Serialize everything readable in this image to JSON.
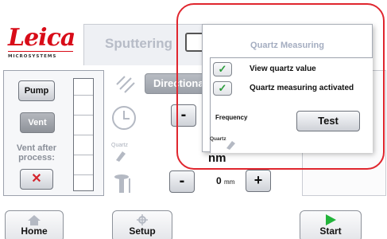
{
  "app": {
    "logo_text": "Leica",
    "logo_subtext": "MICROSYSTEMS",
    "tab_label": "Sputtering"
  },
  "left_panel": {
    "pump_label": "Pump",
    "vent_label": "Vent",
    "vent_after_label": "Vent after process:",
    "vent_after_value": "✕"
  },
  "middle": {
    "direction_label": "Directional",
    "quartz_icon_label": "Quartz",
    "minus_label": "-",
    "plus_label": "+",
    "thickness_unit": "nm",
    "distance_value": "0",
    "distance_unit": "mm"
  },
  "popup": {
    "title": "Quartz Measuring",
    "options": [
      {
        "label": "View quartz value",
        "checked": true,
        "mark": "✓"
      },
      {
        "label": "Quartz measuring activated",
        "checked": true,
        "mark": "✓"
      }
    ],
    "frequency_label": "Frequency",
    "test_button": "Test",
    "quartz_label": "Quartz"
  },
  "bottom_nav": {
    "home": "Home",
    "setup": "Setup",
    "start": "Start"
  },
  "colors": {
    "brand_red": "#d80c18",
    "highlight_red": "#e0262e",
    "check_green": "#2a9b3a",
    "start_green": "#22b43a"
  }
}
